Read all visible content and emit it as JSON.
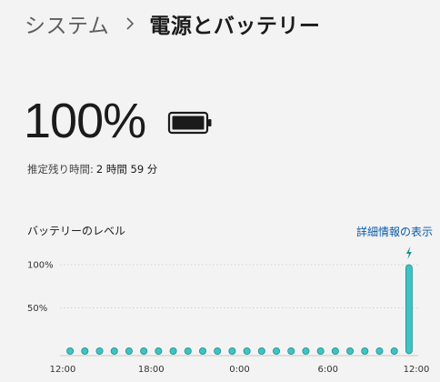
{
  "breadcrumb": {
    "parent": "システム",
    "current": "電源とバッテリー"
  },
  "battery": {
    "percentage_text": "100%",
    "charge_level": 1.0,
    "remaining_label": "推定残り時間:",
    "remaining_value": "2 時間 59 分"
  },
  "level_section": {
    "title": "バッテリーのレベル",
    "details_link": "詳細情報の表示"
  },
  "colors": {
    "accent_teal": "#3fc2c2",
    "teal_dark": "#1f8f8f",
    "link": "#0b5aa8"
  },
  "chart_data": {
    "type": "bar",
    "yticks": [
      "100%",
      "50%"
    ],
    "ylim": [
      0,
      100
    ],
    "xticks": [
      "12:00",
      "18:00",
      "0:00",
      "6:00",
      "12:00"
    ],
    "x_hours": [
      0,
      6,
      12,
      18,
      24
    ],
    "samples": [
      {
        "hour": 0.5,
        "value": 0
      },
      {
        "hour": 1.5,
        "value": 0
      },
      {
        "hour": 2.5,
        "value": 0
      },
      {
        "hour": 3.5,
        "value": 0
      },
      {
        "hour": 4.5,
        "value": 0
      },
      {
        "hour": 5.5,
        "value": 0
      },
      {
        "hour": 6.5,
        "value": 0
      },
      {
        "hour": 7.5,
        "value": 0
      },
      {
        "hour": 8.5,
        "value": 0
      },
      {
        "hour": 9.5,
        "value": 0
      },
      {
        "hour": 10.5,
        "value": 0
      },
      {
        "hour": 11.5,
        "value": 0
      },
      {
        "hour": 12.5,
        "value": 0
      },
      {
        "hour": 13.5,
        "value": 0
      },
      {
        "hour": 14.5,
        "value": 0
      },
      {
        "hour": 15.5,
        "value": 0
      },
      {
        "hour": 16.5,
        "value": 0
      },
      {
        "hour": 17.5,
        "value": 0
      },
      {
        "hour": 18.5,
        "value": 0
      },
      {
        "hour": 19.5,
        "value": 0
      },
      {
        "hour": 20.5,
        "value": 0
      },
      {
        "hour": 21.5,
        "value": 0
      },
      {
        "hour": 22.5,
        "value": 0
      },
      {
        "hour": 23.5,
        "value": 100,
        "charging": true
      }
    ],
    "grid": true
  }
}
